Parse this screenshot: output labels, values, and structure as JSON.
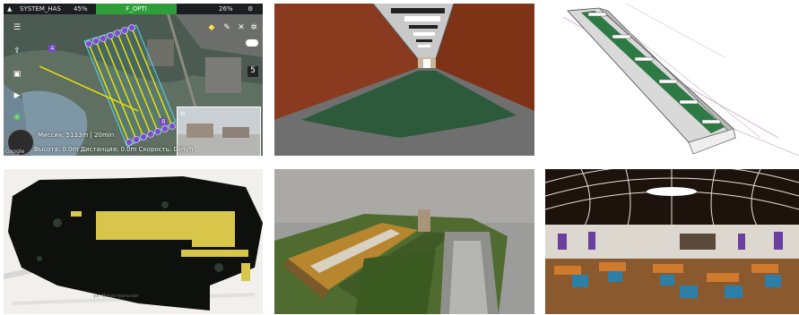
{
  "drone_app": {
    "signal_label": "SYSTEM_HAS",
    "battery_percent": "45%",
    "mode_label": "F_OPTI",
    "remote_battery": "26%",
    "waypoint_count_a": "4",
    "waypoint_count_b": "8",
    "mission_text": "Миссия: 5133m | 20min",
    "telemetry_text": "Высота: 0.0m Дистанция: 0.0m Скорость: 0km/h",
    "map_logo": "Google"
  },
  "map_2d": {
    "street_label": "ул. Магистральная"
  },
  "colors": {
    "flight_line": "#f2e600",
    "waypoint": "#7a4bd6",
    "building_fill": "#d8c64a",
    "corridor_floor": "#2d5a3a",
    "brick_wall": "#8a3a1e"
  }
}
